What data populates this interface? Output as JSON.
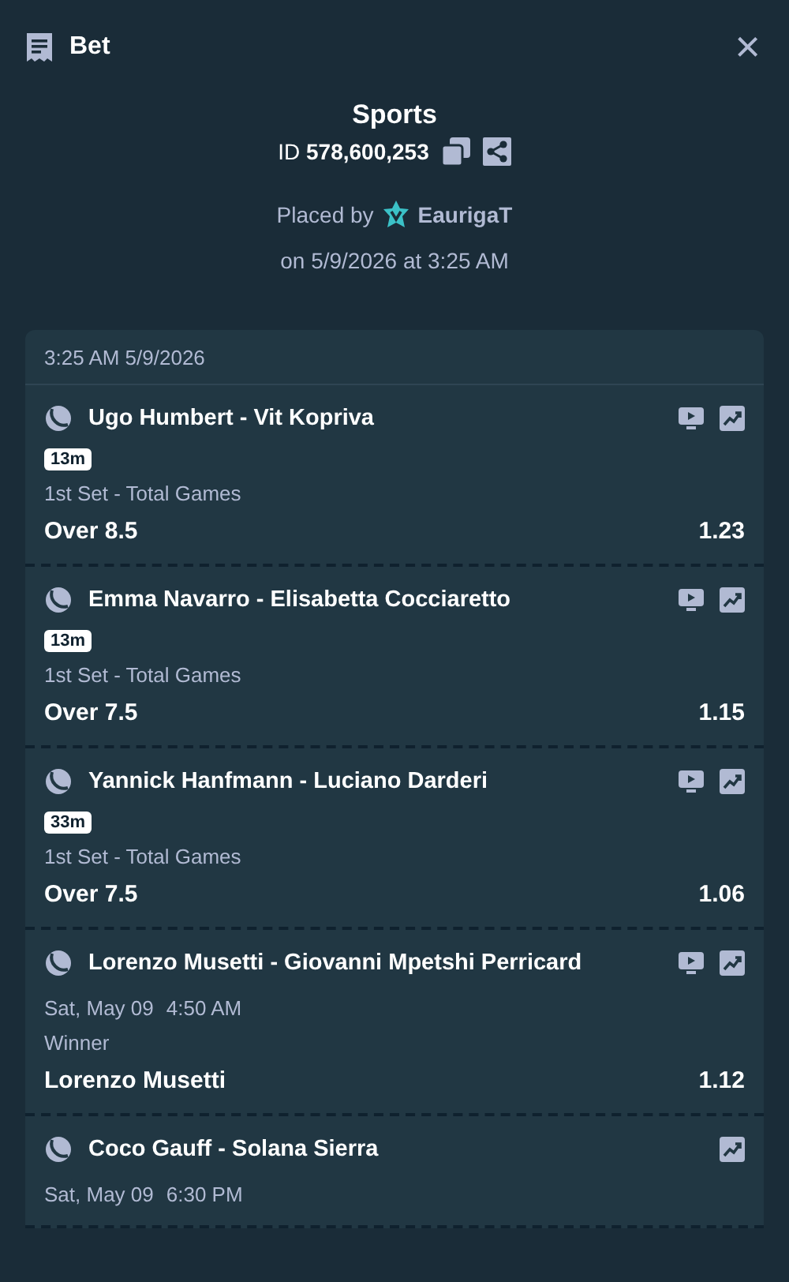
{
  "header": {
    "title": "Bet",
    "close": "×"
  },
  "summary": {
    "title": "Sports",
    "id_label": "ID",
    "id_value": "578,600,253",
    "placed_by": "Placed by",
    "user": "EaurigaT",
    "placed_on": "on 5/9/2026 at 3:25 AM"
  },
  "slip": {
    "timestamp": "3:25 AM 5/9/2026",
    "legs": [
      {
        "match": "Ugo Humbert - Vit Kopriva",
        "kind": "live",
        "badge": "13m",
        "market": "1st Set - Total Games",
        "selection": "Over 8.5",
        "odds": "1.23",
        "stream": true,
        "stats": true
      },
      {
        "match": "Emma Navarro - Elisabetta Cocciaretto",
        "kind": "live",
        "badge": "13m",
        "market": "1st Set - Total Games",
        "selection": "Over 7.5",
        "odds": "1.15",
        "stream": true,
        "stats": true
      },
      {
        "match": "Yannick Hanfmann - Luciano Darderi",
        "kind": "live",
        "badge": "33m",
        "market": "1st Set - Total Games",
        "selection": "Over 7.5",
        "odds": "1.06",
        "stream": true,
        "stats": true
      },
      {
        "match": "Lorenzo Musetti - Giovanni Mpetshi Perricard",
        "kind": "scheduled",
        "date": "Sat, May 09",
        "time": "4:50 AM",
        "market": "Winner",
        "selection": "Lorenzo Musetti",
        "odds": "1.12",
        "stream": true,
        "stats": true
      },
      {
        "match": "Coco Gauff - Solana Sierra",
        "kind": "scheduled",
        "date": "Sat, May 09",
        "time": "6:30 PM",
        "stream": false,
        "stats": true
      }
    ]
  }
}
